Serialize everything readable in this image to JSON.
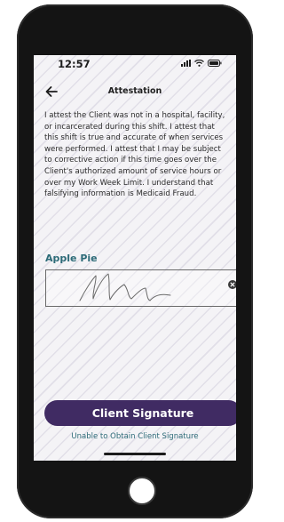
{
  "status_bar": {
    "time": "12:57"
  },
  "nav": {
    "title": "Attestation",
    "back_icon": "arrow-left-icon"
  },
  "attestation_text": "I attest the Client was not in a hospital, facility, or incarcerated during this shift. I attest that this shift is true and accurate of when services were performed. I attest that I may be subject to corrective action if this time goes over the Client's authorized amount of service hours or over my Work Week Limit. I understand that falsifying information is Medicaid Fraud.",
  "signature": {
    "client_name": "Apple Pie",
    "clear_icon": "close-circle-icon"
  },
  "actions": {
    "primary_label": "Client Signature",
    "secondary_label": "Unable to Obtain Client Signature"
  },
  "colors": {
    "primary": "#402b63",
    "accent_teal": "#2d6b78",
    "background": "#f4f3f6"
  }
}
